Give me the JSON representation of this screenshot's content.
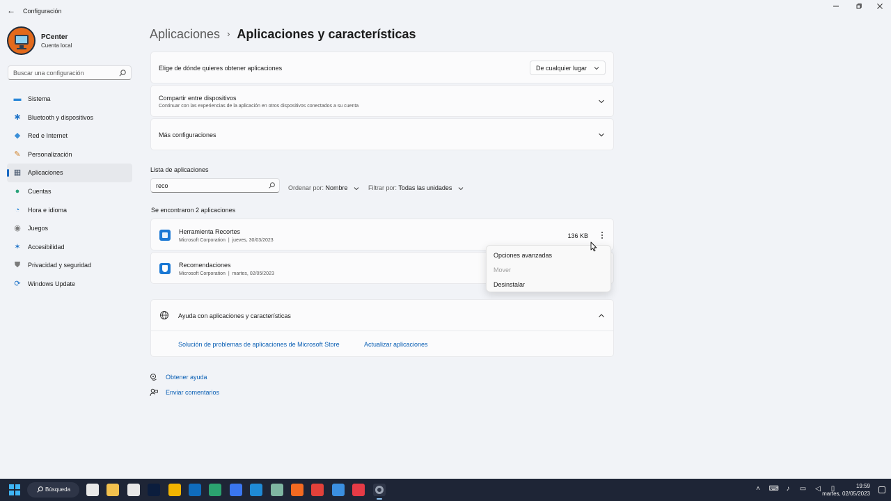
{
  "window": {
    "title": "Configuración",
    "back_icon": "back-arrow-icon",
    "controls": [
      "minimize-icon",
      "restore-icon",
      "close-icon"
    ]
  },
  "profile": {
    "name": "PCenter",
    "account": "Cuenta local"
  },
  "search": {
    "placeholder": "Buscar una configuración"
  },
  "sidebar": {
    "items": [
      {
        "label": "Sistema",
        "icon": "system-icon",
        "color": "#2b88d8"
      },
      {
        "label": "Bluetooth y dispositivos",
        "icon": "bluetooth-icon",
        "color": "#1e73c8"
      },
      {
        "label": "Red e Internet",
        "icon": "wifi-icon",
        "color": "#3a8fd8"
      },
      {
        "label": "Personalización",
        "icon": "brush-icon",
        "color": "#d0822a"
      },
      {
        "label": "Aplicaciones",
        "icon": "apps-icon",
        "color": "#4a5a70",
        "active": true
      },
      {
        "label": "Cuentas",
        "icon": "account-icon",
        "color": "#2aa37a"
      },
      {
        "label": "Hora e idioma",
        "icon": "globe-clock-icon",
        "color": "#2b88d8"
      },
      {
        "label": "Juegos",
        "icon": "gamepad-icon",
        "color": "#7a7a7a"
      },
      {
        "label": "Accesibilidad",
        "icon": "accessibility-icon",
        "color": "#1e73c8"
      },
      {
        "label": "Privacidad y seguridad",
        "icon": "shield-icon",
        "color": "#7a7a7a"
      },
      {
        "label": "Windows Update",
        "icon": "update-icon",
        "color": "#1e73c8"
      }
    ]
  },
  "breadcrumb": {
    "parent": "Aplicaciones",
    "separator": "›",
    "current": "Aplicaciones y características"
  },
  "settings": {
    "source": {
      "title": "Elige de dónde quieres obtener aplicaciones",
      "value": "De cualquier lugar"
    },
    "share": {
      "title": "Compartir entre dispositivos",
      "subtitle": "Continuar con las experiencias de la aplicación en otros dispositivos conectados a su cuenta"
    },
    "more": {
      "title": "Más configuraciones"
    }
  },
  "app_list": {
    "heading": "Lista de aplicaciones",
    "search_value": "reco",
    "sort_label": "Ordenar por:",
    "sort_value": "Nombre",
    "filter_label": "Filtrar por:",
    "filter_value": "Todas las unidades",
    "result_text": "Se encontraron 2 aplicaciones",
    "apps": [
      {
        "name": "Herramienta Recortes",
        "publisher": "Microsoft Corporation",
        "separator": "|",
        "date": "jueves, 30/03/2023",
        "size": "136 KB",
        "icon": "snipping-tool-icon"
      },
      {
        "name": "Recomendaciones",
        "publisher": "Microsoft Corporation",
        "separator": "|",
        "date": "martes, 02/05/2023",
        "size": "",
        "icon": "tips-icon"
      }
    ]
  },
  "context_menu": {
    "items": [
      {
        "label": "Opciones avanzadas",
        "enabled": true
      },
      {
        "label": "Mover",
        "enabled": false
      },
      {
        "label": "Desinstalar",
        "enabled": true
      }
    ]
  },
  "help": {
    "title": "Ayuda con aplicaciones y características",
    "links": [
      "Solución de problemas de aplicaciones de Microsoft Store",
      "Actualizar aplicaciones"
    ]
  },
  "footer": {
    "get_help": "Obtener ayuda",
    "feedback": "Enviar comentarios"
  },
  "taskbar": {
    "search_label": "Búsqueda",
    "apps": [
      {
        "icon": "chatgpt-icon",
        "color": "#e8e8e8"
      },
      {
        "icon": "file-explorer-icon",
        "color": "#f2c14e"
      },
      {
        "icon": "store-icon",
        "color": "#e8e8e8"
      },
      {
        "icon": "photoshop-icon",
        "color": "#0b1d3d"
      },
      {
        "icon": "chrome-icon",
        "color": "#f2b400"
      },
      {
        "icon": "outlook-icon",
        "color": "#0f6cbd"
      },
      {
        "icon": "edge-icon",
        "color": "#2ba36f"
      },
      {
        "icon": "signal-icon",
        "color": "#3a76f0"
      },
      {
        "icon": "vscode-icon",
        "color": "#1f8ad6"
      },
      {
        "icon": "chatgpt-app-icon",
        "color": "#7fb6a2"
      },
      {
        "icon": "firefox-icon",
        "color": "#f36a21"
      },
      {
        "icon": "anydesk-icon",
        "color": "#e2413a"
      },
      {
        "icon": "azure-icon",
        "color": "#3b8fe0"
      },
      {
        "icon": "screen-recorder-icon",
        "color": "#e63b46"
      },
      {
        "icon": "settings-icon",
        "color": "#9aa3b2",
        "active": true
      }
    ],
    "tray_icons": [
      "chevron-up-icon",
      "keyboard-icon",
      "microphone-icon",
      "network-icon",
      "volume-icon",
      "battery-icon"
    ],
    "time": "19:59",
    "date": "martes, 02/05/2023"
  }
}
